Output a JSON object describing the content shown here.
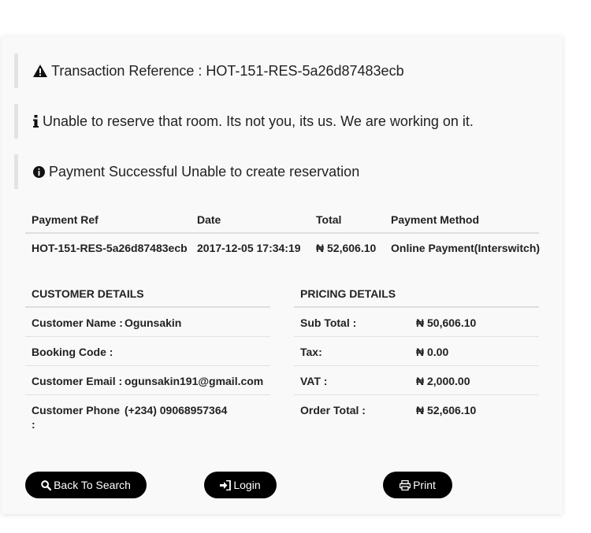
{
  "alerts": {
    "reference": "Transaction Reference : HOT-151-RES-5a26d87483ecb",
    "info": "Unable to reserve that room. Its not you, its us. We are working on it.",
    "status": "Payment Successful Unable to create reservation"
  },
  "payment_table": {
    "headers": [
      "Payment Ref",
      "Date",
      "Total",
      "Payment Method"
    ],
    "row": [
      "HOT-151-RES-5a26d87483ecb",
      "2017-12-05 17:34:19",
      "₦ 52,606.10",
      "Online Payment(Interswitch)"
    ]
  },
  "customer": {
    "heading": "CUSTOMER DETAILS",
    "rows": [
      {
        "label": "Customer Name :",
        "value": "Ogunsakin"
      },
      {
        "label": "Booking Code :",
        "value": ""
      },
      {
        "label": "Customer Email :",
        "value": "ogunsakin191@gmail.com"
      },
      {
        "label": "Customer Phone :",
        "value": "(+234) 09068957364"
      }
    ]
  },
  "pricing": {
    "heading": "PRICING DETAILS",
    "rows": [
      {
        "label": "Sub Total :",
        "value": "₦ 50,606.10"
      },
      {
        "label": "Tax:",
        "value": "₦ 0.00"
      },
      {
        "label": "VAT :",
        "value": "₦ 2,000.00"
      },
      {
        "label": "Order Total :",
        "value": "₦ 52,606.10"
      }
    ]
  },
  "buttons": {
    "back": "Back To Search",
    "login": "Login",
    "print": "Print"
  },
  "icons": {
    "reference": "warning-triangle-icon",
    "info": "info-icon",
    "status": "info-circle-icon",
    "back": "search-icon",
    "login": "sign-in-icon",
    "print": "print-icon"
  }
}
